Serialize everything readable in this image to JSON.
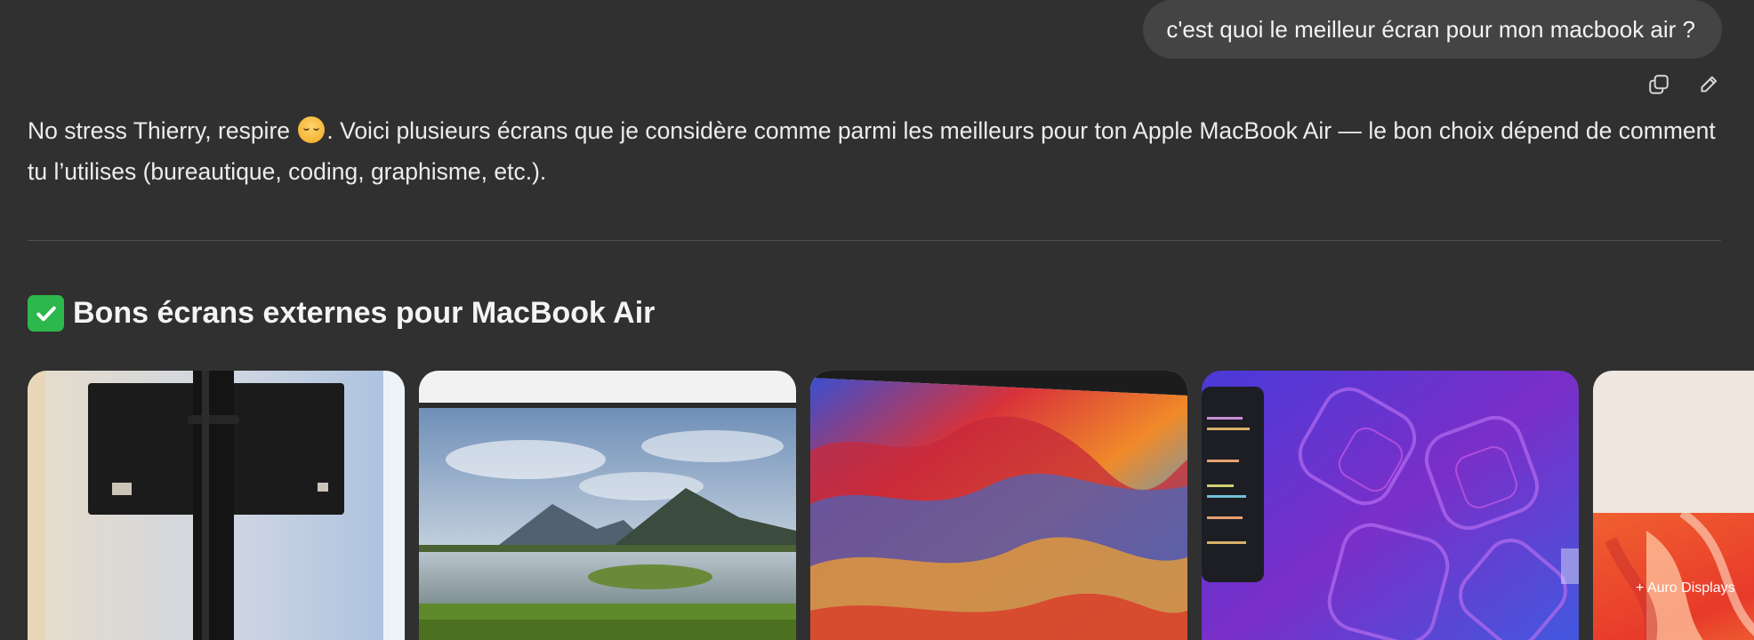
{
  "user_message": {
    "text": "c'est quoi le meilleur écran pour mon macbook air ?"
  },
  "message_actions": {
    "copy_icon": "copy-icon",
    "edit_icon": "pencil-icon"
  },
  "assistant": {
    "intro_before_emoji": "No stress Thierry, respire ",
    "emoji": "relieved-face-emoji",
    "intro_after_emoji": ". Voici plusieurs écrans que je considère comme parmi les meilleurs pour ton Apple MacBook Air — le bon choix dépend de comment tu l’utilises (bureautique, coding, graphisme, etc.).",
    "section_heading": "Bons écrans externes pour MacBook Air",
    "section_icon": "check-mark-icon"
  },
  "gallery": {
    "images": [
      {
        "name": "monitor-stand-photo"
      },
      {
        "name": "landscape-lake-monitor-photo"
      },
      {
        "name": "colorful-mountains-monitor-photo"
      },
      {
        "name": "purple-pattern-code-monitor-photo"
      },
      {
        "name": "auro-displays-photo",
        "overlay_text": "+ Auro Displays"
      }
    ]
  },
  "colors": {
    "background": "#303030",
    "bubble": "#444444",
    "text": "#ececec",
    "check_green": "#2db84d"
  }
}
